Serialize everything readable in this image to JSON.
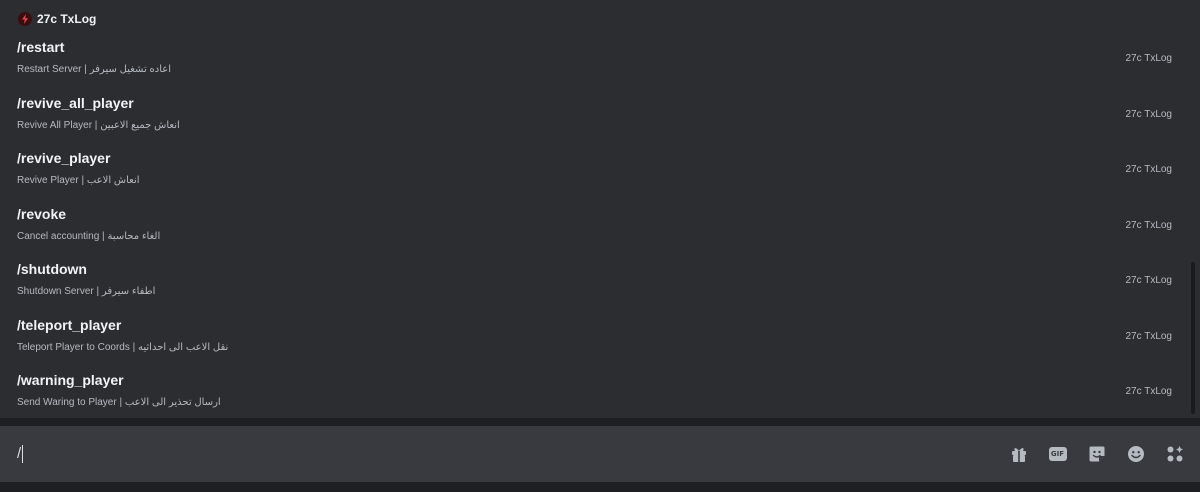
{
  "app": {
    "name": "27c TxLog",
    "icon": "lightning-bolt-icon",
    "icon_color": "#e8464a"
  },
  "commands": [
    {
      "name": "/restart",
      "description": "Restart Server | اعاده تشغيل سيرفر",
      "source": "27c TxLog"
    },
    {
      "name": "/revive_all_player",
      "description": "Revive All Player | انعاش جميع الاعبين",
      "source": "27c TxLog"
    },
    {
      "name": "/revive_player",
      "description": "Revive Player | انعاش الاعب",
      "source": "27c TxLog"
    },
    {
      "name": "/revoke",
      "description": "Cancel accounting | الغاء محاسبة",
      "source": "27c TxLog"
    },
    {
      "name": "/shutdown",
      "description": "Shutdown Server | اطفاء سيرفر",
      "source": "27c TxLog"
    },
    {
      "name": "/teleport_player",
      "description": "Teleport Player to Coords | نقل الاعب الى احداثيه",
      "source": "27c TxLog"
    },
    {
      "name": "/warning_player",
      "description": "Send Waring to Player | ارسال تحذير الى الاعب",
      "source": "27c TxLog"
    }
  ],
  "input": {
    "value": "/",
    "icons": [
      "gift-icon",
      "gif-icon",
      "sticker-icon",
      "emoji-icon",
      "apps-icon"
    ],
    "gif_label": "GIF"
  },
  "colors": {
    "popup_bg": "#2b2d31",
    "input_bg": "#383a40",
    "text_primary": "#f2f3f5",
    "text_secondary": "#b5bac1"
  }
}
